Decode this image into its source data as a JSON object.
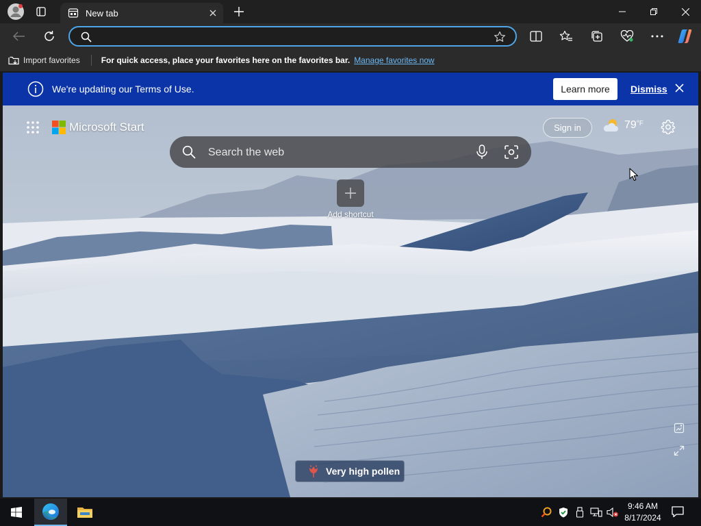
{
  "tab": {
    "title": "New tab"
  },
  "address": {
    "value": "",
    "placeholder": ""
  },
  "favbar": {
    "import_label": "Import favorites",
    "hint": "For quick access, place your favorites here on the favorites bar.",
    "manage_link": "Manage favorites now"
  },
  "banner": {
    "text": "We're updating our Terms of Use.",
    "learn_more": "Learn more",
    "dismiss": "Dismiss"
  },
  "start_page": {
    "brand": "Microsoft Start",
    "sign_in": "Sign in",
    "weather_temp": "79",
    "weather_unit": "°F",
    "search_placeholder": "Search the web",
    "add_shortcut": "Add shortcut",
    "pollen": "Very high pollen"
  },
  "taskbar": {
    "time": "9:46 AM",
    "date": "8/17/2024"
  },
  "colors": {
    "banner": "#0b34a8",
    "accent": "#4ea6e8",
    "link": "#6cb8f5",
    "pollen_icon": "#e0554a"
  },
  "icons": {
    "profile": "profile-avatar-icon",
    "tab_actions": "tab-actions-icon",
    "new_tab": "plus-icon",
    "back": "back-arrow-icon",
    "refresh": "refresh-icon",
    "search": "search-icon",
    "favorite": "star-icon",
    "split": "split-screen-icon",
    "favorites": "favorites-icon",
    "collections": "collections-icon",
    "health": "browser-essentials-icon",
    "more": "more-dots-icon",
    "copilot": "copilot-icon",
    "info": "info-icon",
    "close": "close-icon",
    "apps": "app-launcher-icon",
    "weather": "partly-cloudy-icon",
    "settings": "gear-icon",
    "mic": "microphone-icon",
    "visual_search": "visual-search-icon",
    "pollen": "pollen-flower-icon",
    "windows": "windows-logo-icon",
    "edge": "edge-logo-icon",
    "explorer": "folder-icon",
    "notifications": "notification-icon"
  }
}
